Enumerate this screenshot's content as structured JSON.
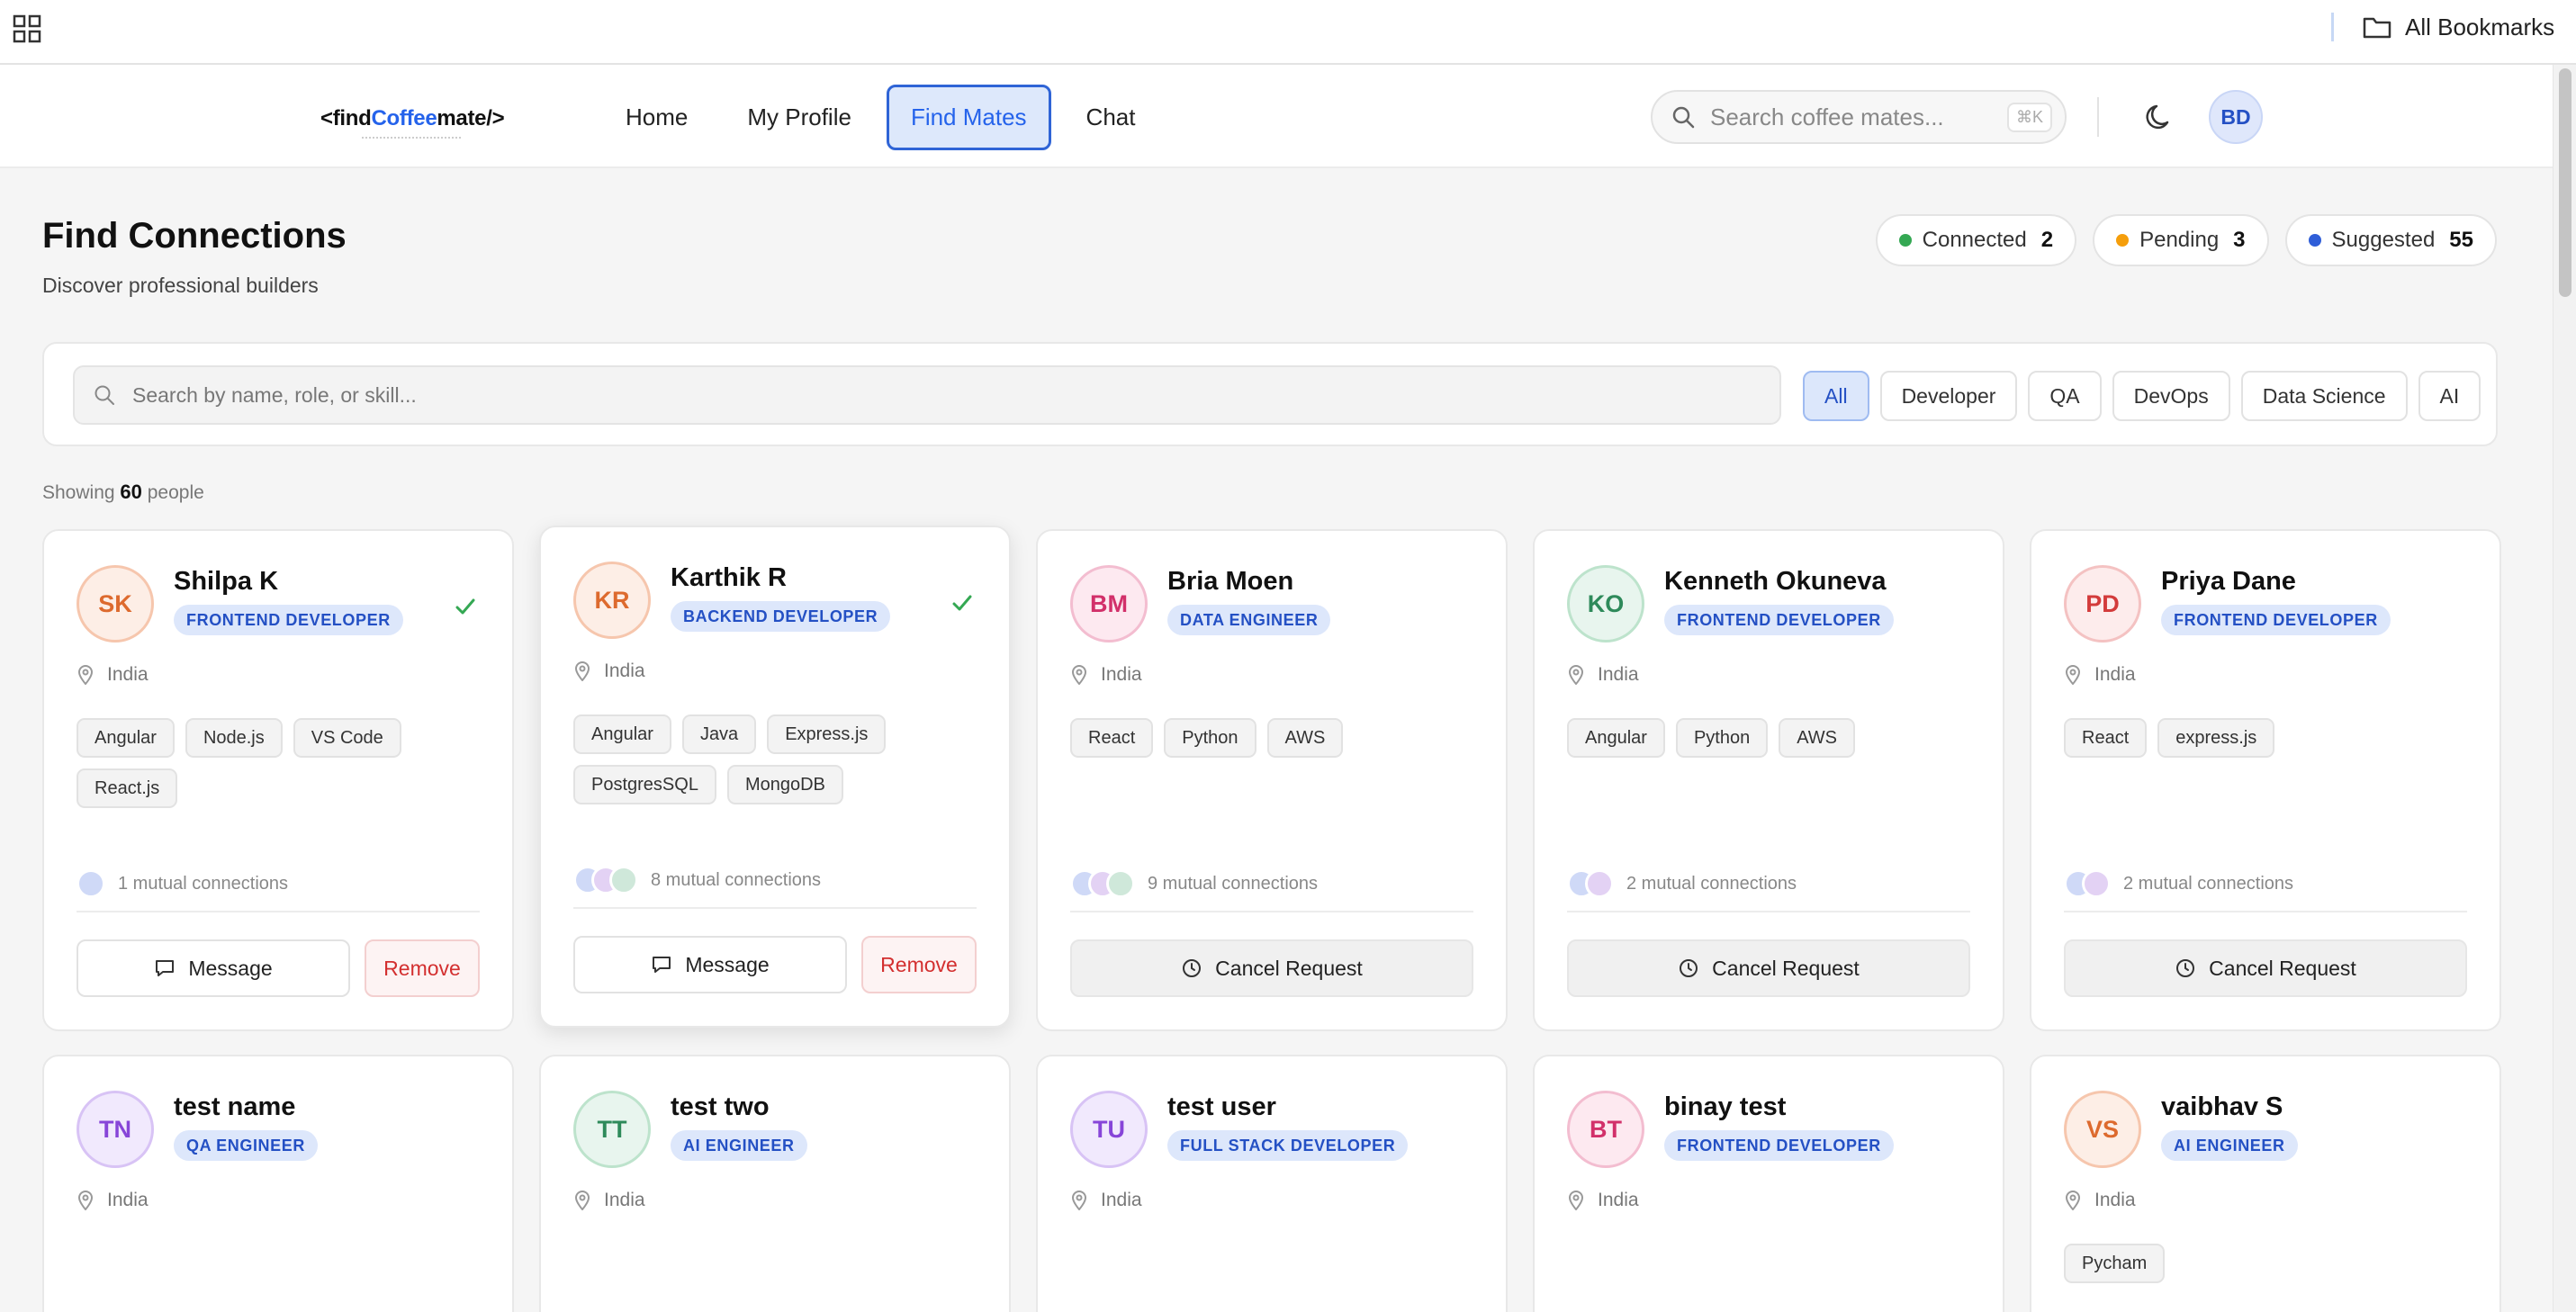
{
  "bookmarks_bar": {
    "all_bookmarks_label": "All Bookmarks"
  },
  "header": {
    "logo_prefix": "<find",
    "logo_accent": "Coffee",
    "logo_suffix": "mate/>",
    "nav": [
      {
        "label": "Home",
        "active": false
      },
      {
        "label": "My Profile",
        "active": false
      },
      {
        "label": "Find Mates",
        "active": true
      },
      {
        "label": "Chat",
        "active": false
      }
    ],
    "search_placeholder": "Search coffee mates...",
    "search_shortcut": "⌘K",
    "user_initials": "BD"
  },
  "page": {
    "title": "Find Connections",
    "subtitle": "Discover professional builders"
  },
  "stats": [
    {
      "label": "Connected",
      "value": "2",
      "color": "#34a853"
    },
    {
      "label": "Pending",
      "value": "3",
      "color": "#f59e0b"
    },
    {
      "label": "Suggested",
      "value": "55",
      "color": "#2f5ed8"
    }
  ],
  "filters": {
    "search_placeholder": "Search by name, role, or skill...",
    "chips": [
      {
        "label": "All",
        "active": true
      },
      {
        "label": "Developer",
        "active": false
      },
      {
        "label": "QA",
        "active": false
      },
      {
        "label": "DevOps",
        "active": false
      },
      {
        "label": "Data Science",
        "active": false
      },
      {
        "label": "AI",
        "active": false
      }
    ]
  },
  "results": {
    "showing_prefix": "Showing",
    "count": "60",
    "suffix": "people"
  },
  "actions": {
    "message": "Message",
    "remove": "Remove",
    "cancel_request": "Cancel Request"
  },
  "colors": {
    "accent": "#2563eb",
    "remove_red": "#d32f2f",
    "check_green": "#34a853"
  },
  "people": [
    {
      "initials": "SK",
      "name": "Shilpa K",
      "role": "FRONTEND DEVELOPER",
      "location": "India",
      "skills": [
        "Angular",
        "Node.js",
        "VS Code",
        "React.js"
      ],
      "mutual_count": 1,
      "mutual_text": "1 mutual connections",
      "status": "connected",
      "avatar_bg": "#fdeee6",
      "avatar_fg": "#dd6a2e",
      "avatar_border": "#f6c6ad"
    },
    {
      "initials": "KR",
      "name": "Karthik R",
      "role": "BACKEND DEVELOPER",
      "location": "India",
      "skills": [
        "Angular",
        "Java",
        "Express.js",
        "PostgresSQL",
        "MongoDB"
      ],
      "mutual_count": 3,
      "mutual_text": "8 mutual connections",
      "status": "connected",
      "avatar_bg": "#fdeee6",
      "avatar_fg": "#dd6a2e",
      "avatar_border": "#f6c6ad"
    },
    {
      "initials": "BM",
      "name": "Bria Moen",
      "role": "DATA ENGINEER",
      "location": "India",
      "skills": [
        "React",
        "Python",
        "AWS"
      ],
      "mutual_count": 3,
      "mutual_text": "9 mutual connections",
      "status": "pending",
      "avatar_bg": "#fde9f0",
      "avatar_fg": "#d2306a",
      "avatar_border": "#f3bdd0"
    },
    {
      "initials": "KO",
      "name": "Kenneth Okuneva",
      "role": "FRONTEND DEVELOPER",
      "location": "India",
      "skills": [
        "Angular",
        "Python",
        "AWS"
      ],
      "mutual_count": 2,
      "mutual_text": "2 mutual connections",
      "status": "pending",
      "avatar_bg": "#e8f5ee",
      "avatar_fg": "#2e8a5a",
      "avatar_border": "#bde3cc"
    },
    {
      "initials": "PD",
      "name": "Priya Dane",
      "role": "FRONTEND DEVELOPER",
      "location": "India",
      "skills": [
        "React",
        "express.js"
      ],
      "mutual_count": 2,
      "mutual_text": "2 mutual connections",
      "status": "pending",
      "avatar_bg": "#fdecec",
      "avatar_fg": "#d33b3b",
      "avatar_border": "#f4c2c2"
    },
    {
      "initials": "TN",
      "name": "test name",
      "role": "QA ENGINEER",
      "location": "India",
      "skills": [],
      "status": "suggested",
      "avatar_bg": "#f1e9fd",
      "avatar_fg": "#8745d8",
      "avatar_border": "#d8c3f5"
    },
    {
      "initials": "TT",
      "name": "test two",
      "role": "AI ENGINEER",
      "location": "India",
      "skills": [],
      "status": "suggested",
      "avatar_bg": "#e8f5ee",
      "avatar_fg": "#2e8a5a",
      "avatar_border": "#bde3cc"
    },
    {
      "initials": "TU",
      "name": "test user",
      "role": "FULL STACK DEVELOPER",
      "location": "India",
      "skills": [],
      "status": "suggested",
      "avatar_bg": "#f1e9fd",
      "avatar_fg": "#8745d8",
      "avatar_border": "#d8c3f5"
    },
    {
      "initials": "BT",
      "name": "binay test",
      "role": "FRONTEND DEVELOPER",
      "location": "India",
      "skills": [],
      "status": "suggested",
      "avatar_bg": "#fde9f0",
      "avatar_fg": "#d2306a",
      "avatar_border": "#f3bdd0"
    },
    {
      "initials": "VS",
      "name": "vaibhav S",
      "role": "AI ENGINEER",
      "location": "India",
      "skills": [
        "Pycham"
      ],
      "status": "suggested",
      "avatar_bg": "#fdeee6",
      "avatar_fg": "#dd6a2e",
      "avatar_border": "#f6c6ad"
    }
  ]
}
